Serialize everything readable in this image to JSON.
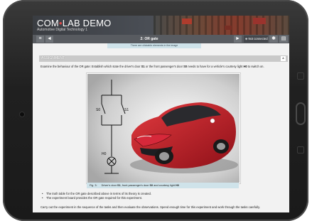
{
  "app": {
    "title_left": "COM",
    "title_sep": "•",
    "title_right": "LAB DEMO",
    "subtitle": "Automotive Digital Technology 1"
  },
  "toolbar": {
    "menu_icon": "≡",
    "back_icon": "◄",
    "page_title": "2: OR gate",
    "next_icon": "►",
    "connection_status": "Not connected",
    "settings_icon": "✱",
    "folder_icon": "▤"
  },
  "notice": "There are clickable elements in the image",
  "section": {
    "label": "ASSIGNMENT",
    "caret": "▲"
  },
  "instruction": {
    "part1": "Examine the behaviour of the OR gate: Establish which state the driver's door ",
    "s1": "S1",
    "part2": " or the front passenger's door ",
    "s0": "S0",
    "part3": " needs to have for a vehicle's courtesy light ",
    "h0": "H0",
    "part4": " to switch on."
  },
  "figure": {
    "labels": {
      "s0": "S0",
      "s1": "S1",
      "h0": "H0"
    },
    "caption_number": "Fig. 3:",
    "caption_text_1": "Driver's door ",
    "caption_s1": "S1",
    "caption_text_2": ", front passenger's door ",
    "caption_s0": "S0",
    "caption_text_3": " and courtesy light ",
    "caption_h0": "H0",
    "car_color": "#c41e2a"
  },
  "bullets": [
    "The truth table for the OR gate described above in terms of its theory is created.",
    "The experiment board provides the OR gate required for this experiment."
  ],
  "final_text": "Carry out the experiment in the sequence of the tasks and then evaluate the observations. Spend enough time for this experiment and work through the tasks carefully.",
  "colors": {
    "accent_red": "#e04848",
    "toolbar": "#585b60",
    "notice_bg": "#cfe3ea"
  }
}
